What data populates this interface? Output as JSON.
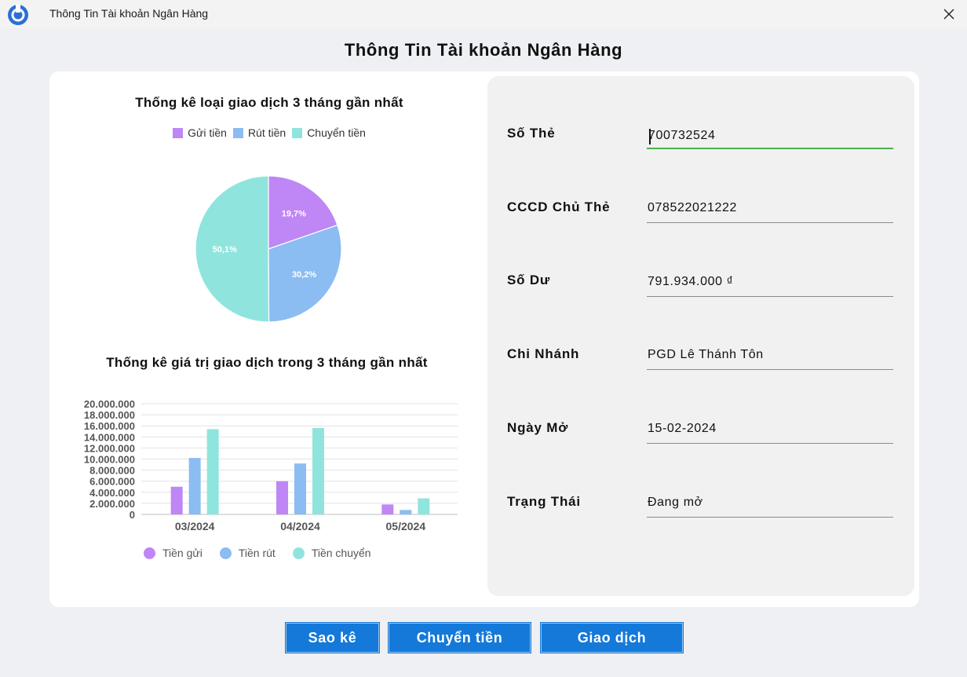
{
  "window": {
    "title": "Thông Tin Tài khoản Ngân Hàng"
  },
  "header": {
    "title": "Thông Tin Tài khoản Ngân Hàng"
  },
  "colors": {
    "purple": "#bf86f5",
    "blue": "#8bbcf2",
    "teal": "#8fe5dd",
    "button": "#1479d9",
    "active_underline": "#4caf50"
  },
  "pie_chart": {
    "title": "Thống kê loại giao dịch 3 tháng gần nhất",
    "legend": [
      "Gửi tiền",
      "Rút tiền",
      "Chuyển tiền"
    ],
    "labels": [
      "19,7%",
      "30,2%",
      "50,1%"
    ]
  },
  "bar_chart": {
    "title": "Thống kê giá trị giao dịch trong 3 tháng gần nhất",
    "legend": [
      "Tiền gửi",
      "Tiền rút",
      "Tiền chuyển"
    ]
  },
  "chart_data": [
    {
      "type": "pie",
      "title": "Thống kê loại giao dịch 3 tháng gần nhất",
      "categories": [
        "Gửi tiền",
        "Rút tiền",
        "Chuyển tiền"
      ],
      "values": [
        19.7,
        30.2,
        50.1
      ],
      "labels": [
        "19,7%",
        "30,2%",
        "50,1%"
      ],
      "colors": [
        "#bf86f5",
        "#8bbcf2",
        "#8fe5dd"
      ],
      "legend": "top"
    },
    {
      "type": "bar",
      "title": "Thống kê giá trị giao dịch trong 3 tháng gần nhất",
      "categories": [
        "03/2024",
        "04/2024",
        "05/2024"
      ],
      "series": [
        {
          "name": "Tiền gửi",
          "values": [
            5000000,
            6000000,
            1800000
          ],
          "color": "#bf86f5"
        },
        {
          "name": "Tiền rút",
          "values": [
            10200000,
            9200000,
            800000
          ],
          "color": "#8bbcf2"
        },
        {
          "name": "Tiền chuyển",
          "values": [
            15400000,
            15600000,
            2900000
          ],
          "color": "#8fe5dd"
        }
      ],
      "ylim": [
        0,
        20000000
      ],
      "yticks": [
        "0",
        "2.000.000",
        "4.000.000",
        "6.000.000",
        "8.000.000",
        "10.000.000",
        "12.000.000",
        "14.000.000",
        "16.000.000",
        "18.000.000",
        "20.000.000"
      ],
      "grid": true,
      "legend": "bottom"
    }
  ],
  "account": {
    "fields": [
      {
        "label": "Số Thẻ",
        "value": "700732524"
      },
      {
        "label": "CCCD Chủ Thẻ",
        "value": "078522021222"
      },
      {
        "label": "Số Dư",
        "value": "791.934.000 ₫"
      },
      {
        "label": "Chi Nhánh",
        "value": "PGD Lê Thánh Tôn"
      },
      {
        "label": "Ngày Mở",
        "value": "15-02-2024"
      },
      {
        "label": "Trạng Thái",
        "value": "Đang mở"
      }
    ]
  },
  "buttons": {
    "statement": "Sao kê",
    "transfer": "Chuyển tiền",
    "transactions": "Giao dịch"
  }
}
